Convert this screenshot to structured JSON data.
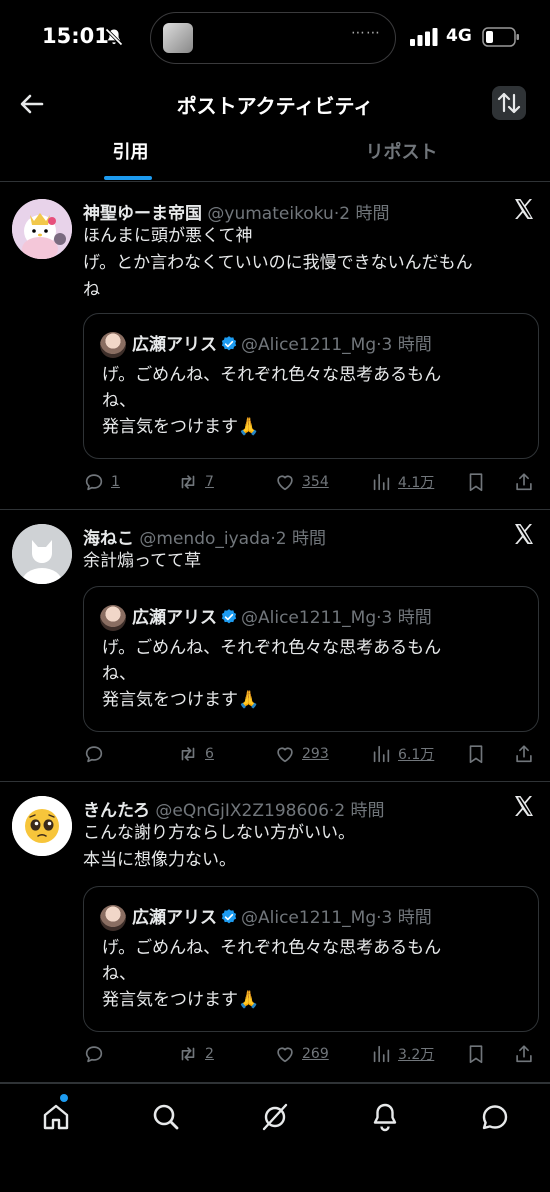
{
  "status_bar": {
    "time": "15:01",
    "network": "4G"
  },
  "header": {
    "title": "ポストアクティビティ"
  },
  "tabs": [
    {
      "label": "引用"
    },
    {
      "label": "リポスト"
    }
  ],
  "quoted_post": {
    "name": "広瀬アリス",
    "handle": "@Alice1211_Mg",
    "dot": "·",
    "time": "3 時間",
    "text_line1": "げ。ごめんね、それぞれ色々な思考あるもん",
    "text_line2": "ね、",
    "text_line3": "発言気をつけます🙏"
  },
  "posts": [
    {
      "name": "神聖ゆーま帝国",
      "handle": "@yumateikoku",
      "dot": "·",
      "time": "2 時間",
      "text_line1": "ほんまに頭が悪くて神",
      "text_line2": "げ。とか言わなくていいのに我慢できないんだもん",
      "text_line3": "ね",
      "replies": "1",
      "reposts": "7",
      "likes": "354",
      "views": "4.1万"
    },
    {
      "name": "海ねこ",
      "handle": "@mendo_iyada",
      "dot": "·",
      "time": "2 時間",
      "text_line1": "余計煽ってて草",
      "replies": "",
      "reposts": "6",
      "likes": "293",
      "views": "6.1万"
    },
    {
      "name": "きんたろ",
      "handle": "@eQnGjIX2Z198606",
      "dot": "·",
      "time": "2 時間",
      "text_line1": "こんな謝り方ならしない方がいい。",
      "text_line2": "本当に想像力ない。",
      "replies": "",
      "reposts": "2",
      "likes": "269",
      "views": "3.2万"
    }
  ],
  "colors": {
    "accent": "#1d9bf0",
    "muted": "#71767b",
    "border": "#2f3336",
    "background": "#000000"
  }
}
